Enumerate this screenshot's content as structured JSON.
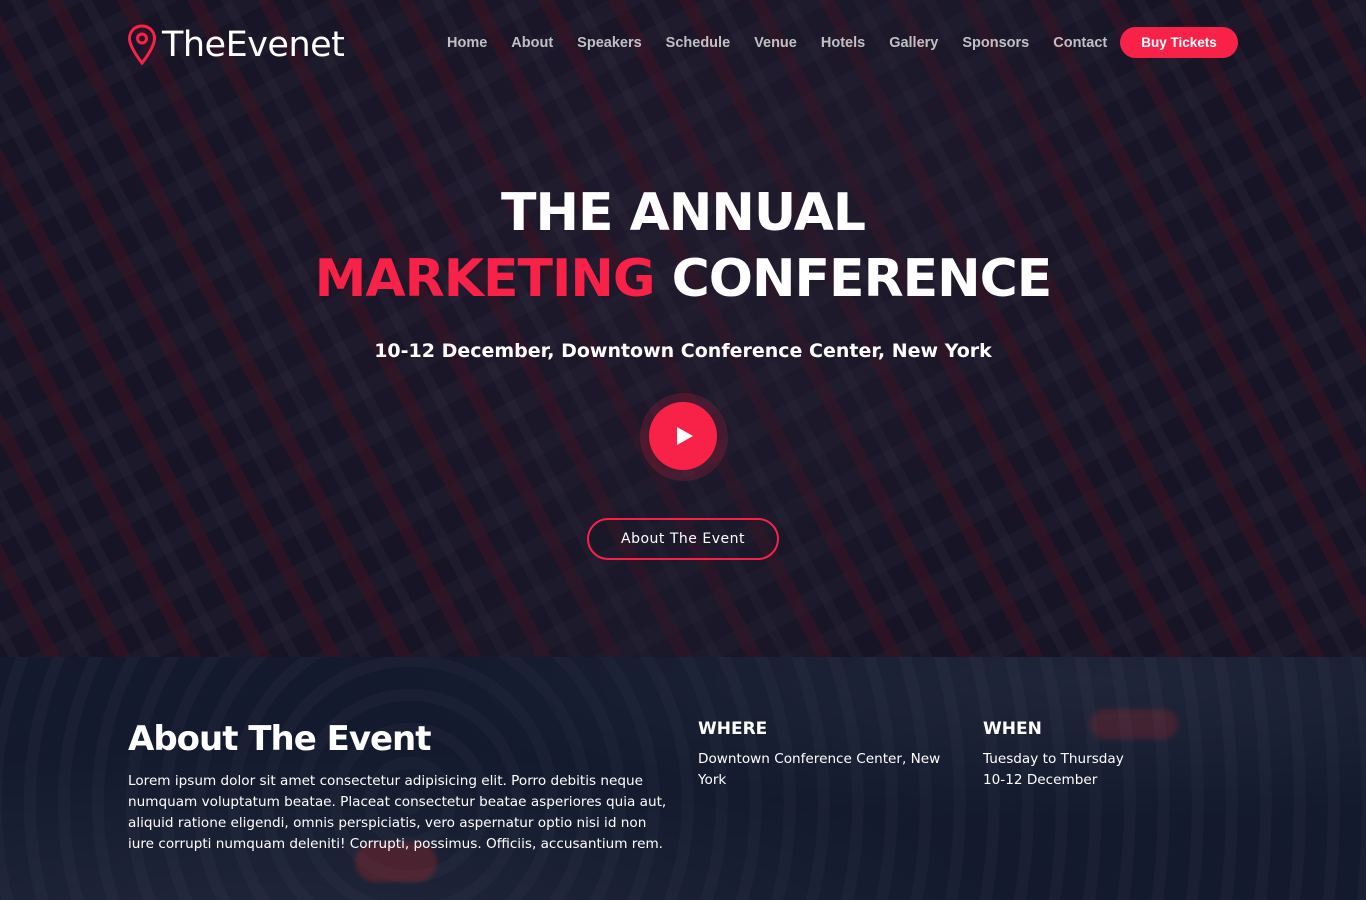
{
  "header": {
    "logo_text": "TheEvenet",
    "logo_icon": "map-pin-icon",
    "nav": [
      "Home",
      "About",
      "Speakers",
      "Schedule",
      "Venue",
      "Hotels",
      "Gallery",
      "Sponsors",
      "Contact"
    ],
    "buy_tickets": "Buy Tickets"
  },
  "hero": {
    "title_line1": "THE ANNUAL",
    "title_accent": "MARKETING",
    "title_rest": " CONFERENCE",
    "subtitle": "10-12 December, Downtown Conference Center, New York",
    "play_icon": "play-icon",
    "about_button": "About The Event"
  },
  "about": {
    "heading": "About The Event",
    "text": "Lorem ipsum dolor sit amet consectetur adipisicing elit. Porro debitis neque numquam voluptatum beatae. Placeat consectetur beatae asperiores quia aut, aliquid ratione eligendi, omnis perspiciatis, vero aspernatur optio nisi id non iure corrupti numquam deleniti! Corrupti, possimus. Officiis, accusantium rem.",
    "where_label": "WHERE",
    "where_line1": "Downtown Conference Center, New",
    "where_line2": "York",
    "when_label": "WHEN",
    "when_line1": "Tuesday to Thursday",
    "when_line2": "10-12 December"
  },
  "colors": {
    "accent": "#f82249",
    "section_bg": "#141a2e"
  }
}
